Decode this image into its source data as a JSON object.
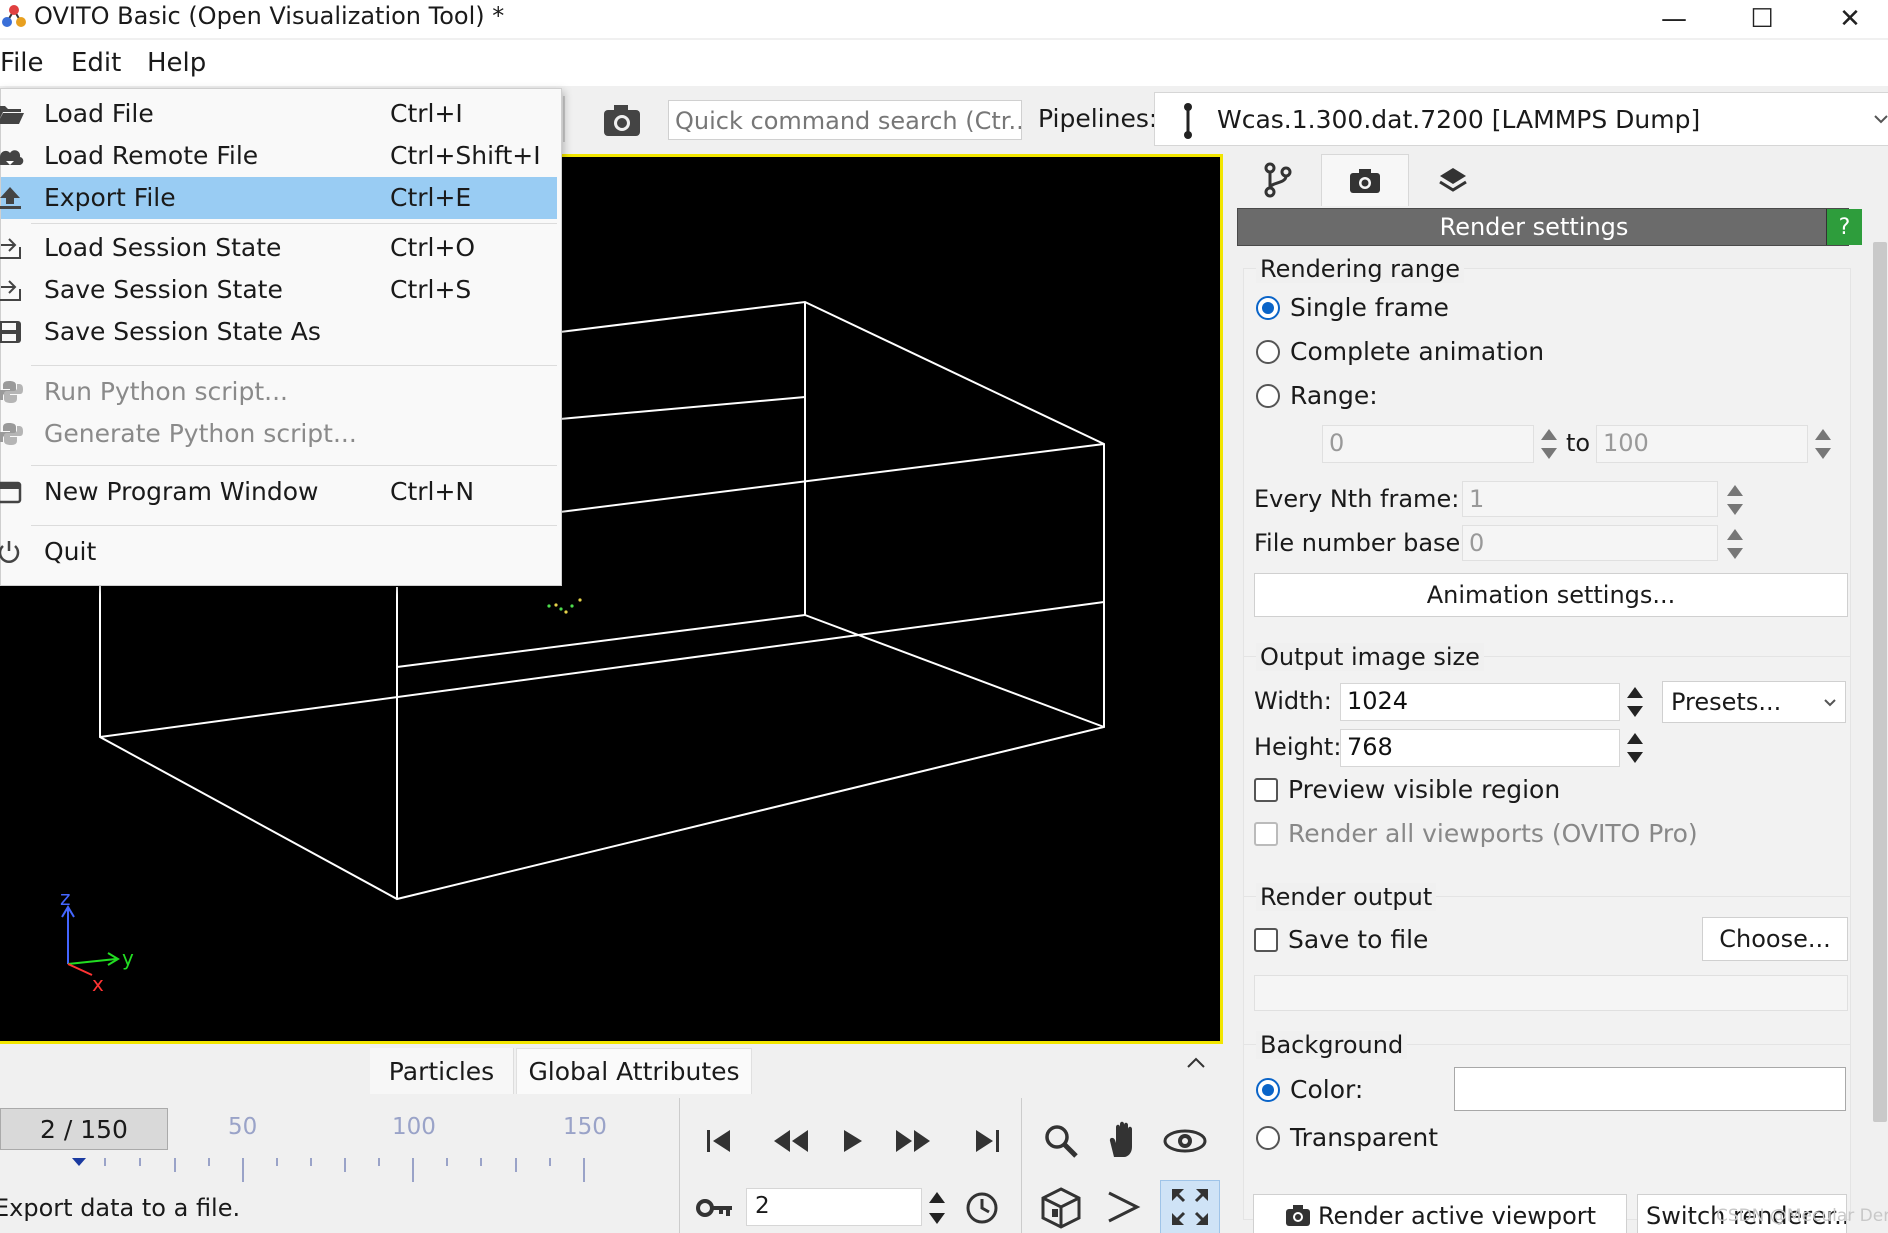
{
  "window": {
    "title": "OVITO Basic (Open Visualization Tool) *",
    "minimize_glyph": "—",
    "maximize_glyph": "☐",
    "close_glyph": "✕"
  },
  "menubar": [
    "File",
    "Edit",
    "Help"
  ],
  "toolbar": {
    "search_placeholder": "Quick command search (Ctr...",
    "pipelines_label": "Pipelines:",
    "pipeline_name": "Wcas.1.300.dat.7200 [LAMMPS Dump]"
  },
  "file_menu": {
    "items": [
      {
        "label": "Load File",
        "shortcut": "Ctrl+I",
        "icon": "folder-open-icon"
      },
      {
        "label": "Load Remote File",
        "shortcut": "Ctrl+Shift+I",
        "icon": "cloud-download-icon"
      },
      {
        "label": "Export File",
        "shortcut": "Ctrl+E",
        "icon": "upload-icon"
      },
      {
        "label": "Load Session State",
        "shortcut": "Ctrl+O",
        "icon": "session-load-icon"
      },
      {
        "label": "Save Session State",
        "shortcut": "Ctrl+S",
        "icon": "session-save-icon"
      },
      {
        "label": "Save Session State As",
        "shortcut": "",
        "icon": "floppy-icon"
      },
      {
        "label": "Run Python script...",
        "shortcut": "",
        "icon": "python-icon"
      },
      {
        "label": "Generate Python script...",
        "shortcut": "",
        "icon": "python-icon"
      },
      {
        "label": "New Program Window",
        "shortcut": "Ctrl+N",
        "icon": "window-icon"
      },
      {
        "label": "Quit",
        "shortcut": "",
        "icon": "power-icon"
      }
    ]
  },
  "viewport": {
    "axis_z": "z",
    "axis_y": "y",
    "axis_x": "x"
  },
  "data_tabs": [
    "Particles",
    "Global Attributes"
  ],
  "timeline": {
    "frame_counter": "2 / 150",
    "tick_labels": [
      "50",
      "100",
      "150"
    ],
    "status": "Export data to a file."
  },
  "animation": {
    "current_frame": "2"
  },
  "render_panel": {
    "header": "Render settings",
    "help": "?",
    "rendering_range": {
      "title": "Rendering range",
      "single_frame": "Single frame",
      "complete_animation": "Complete animation",
      "range": "Range:",
      "range_from": "0",
      "range_to_label": "to",
      "range_to": "100",
      "every_nth_label": "Every Nth frame:",
      "every_nth": "1",
      "file_number_base_label": "File number base:",
      "file_number_base": "0",
      "animation_settings": "Animation settings..."
    },
    "output_size": {
      "title": "Output image size",
      "width_label": "Width:",
      "width": "1024",
      "height_label": "Height:",
      "height": "768",
      "presets": "Presets...",
      "preview_visible": "Preview visible region",
      "render_all": "Render all viewports (OVITO Pro)"
    },
    "render_output": {
      "title": "Render output",
      "save_to_file": "Save to file",
      "choose": "Choose..."
    },
    "background": {
      "title": "Background",
      "color": "Color:",
      "transparent": "Transparent"
    },
    "render_active": "Render active viewport",
    "switch_renderer": "Switch renderer..."
  },
  "watermark": "CSDN @Mecular Der",
  "colors": {
    "menu_highlight": "#99ccf3",
    "viewport_border": "#f2e600",
    "help_button": "#2e9d3c",
    "radio_accent": "#0a64c8"
  }
}
